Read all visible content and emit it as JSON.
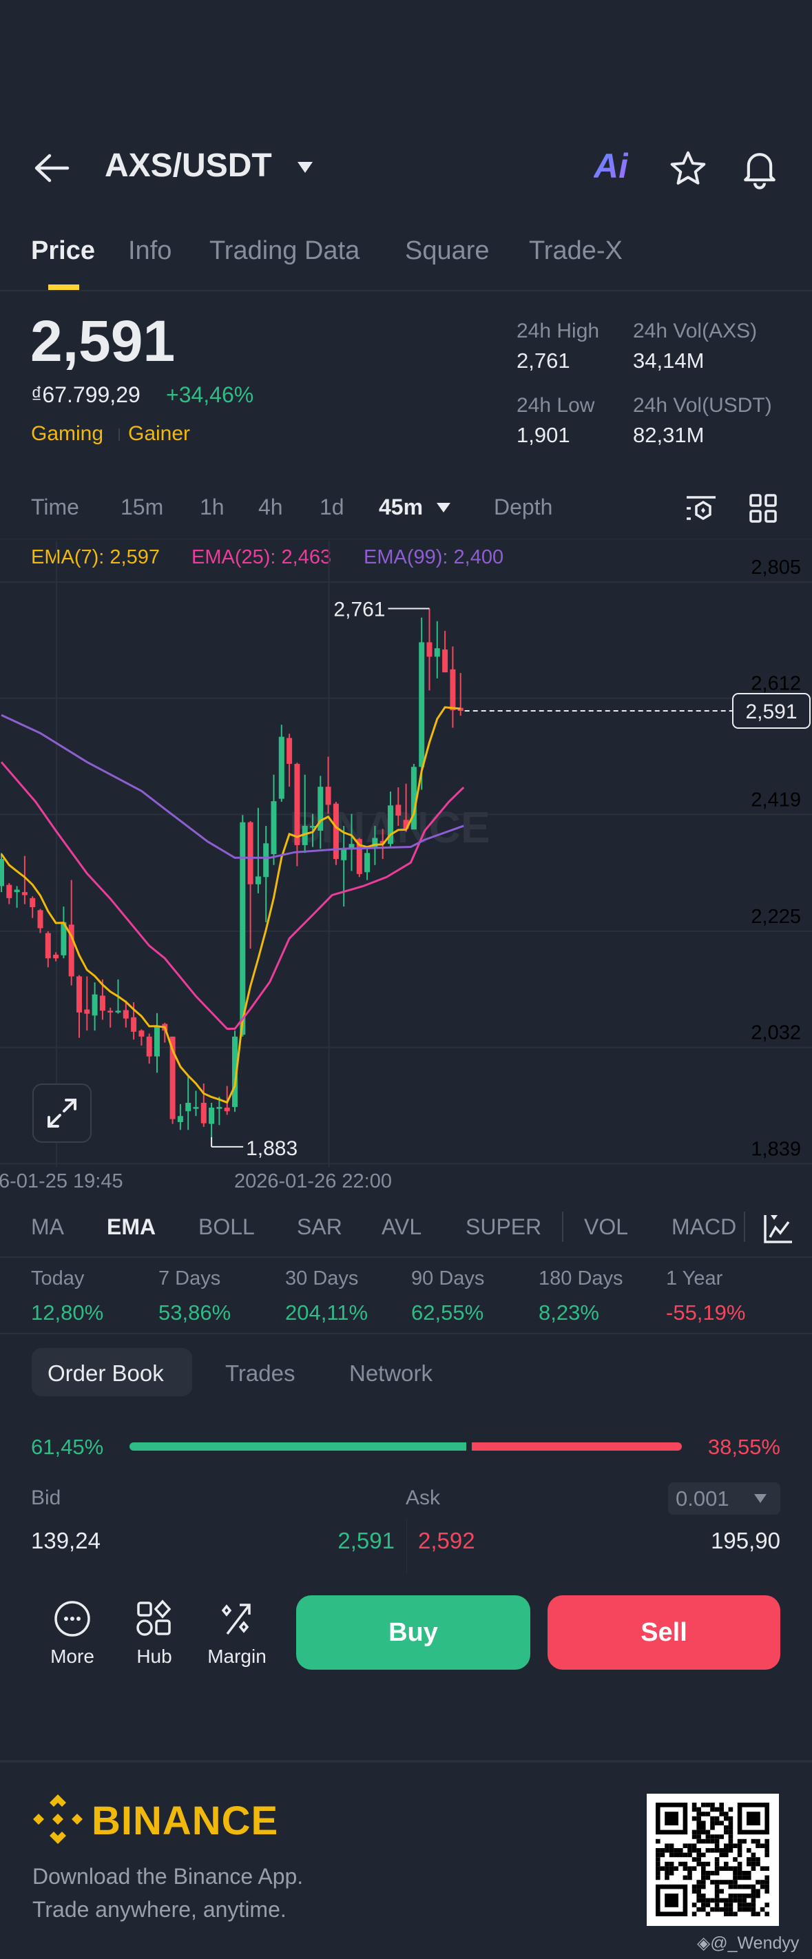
{
  "header": {
    "pair": "AXS/USDT",
    "ai_label": "Ai"
  },
  "tabs": [
    "Price",
    "Info",
    "Trading Data",
    "Square",
    "Trade-X"
  ],
  "price": {
    "last": "2,591",
    "fiat": "₫67.799,29",
    "change": "+34,46%",
    "tags": [
      "Gaming",
      "Gainer"
    ]
  },
  "stats": {
    "high_label": "24h High",
    "high": "2,761",
    "low_label": "24h Low",
    "low": "1,901",
    "vol_base_label": "24h Vol(AXS)",
    "vol_base": "34,14M",
    "vol_quote_label": "24h Vol(USDT)",
    "vol_quote": "82,31M"
  },
  "intervals": [
    "Time",
    "15m",
    "1h",
    "4h",
    "1d",
    "45m",
    "Depth"
  ],
  "ema_legend": {
    "ema7": "EMA(7): 2,597",
    "ema25": "EMA(25): 2,463",
    "ema99": "EMA(99): 2,400"
  },
  "watermark": "BINANCE",
  "chart_data": {
    "type": "candlestick",
    "ylim": [
      1839,
      2805
    ],
    "y_ticks": [
      "2,805",
      "2,612",
      "2,419",
      "2,225",
      "2,032",
      "1,839"
    ],
    "y_tick_values": [
      2805,
      2612,
      2419,
      2225,
      2032,
      1839
    ],
    "x_labels": [
      "6-01-25 19:45",
      "2026-01-26 22:00"
    ],
    "x_label_index": [
      7,
      42
    ],
    "current_price": 2591,
    "current_price_label": "2,591",
    "high_marker": {
      "index": 55,
      "value": 2761,
      "label": "2,761"
    },
    "low_marker": {
      "index": 27,
      "value": 1883,
      "label": "1,883"
    },
    "colors": {
      "up": "#2ebd85",
      "down": "#f6465d",
      "ema7": "#f0b90b",
      "ema25": "#ea3d9c",
      "ema99": "#8e5fd0"
    },
    "ema7_seed": 2356,
    "ohlc": [
      [
        2300,
        2355,
        2290,
        2345
      ],
      [
        2302,
        2305,
        2270,
        2280
      ],
      [
        2290,
        2300,
        2264,
        2294
      ],
      [
        2290,
        2350,
        2270,
        2285
      ],
      [
        2280,
        2283,
        2247,
        2265
      ],
      [
        2260,
        2262,
        2222,
        2230
      ],
      [
        2222,
        2225,
        2165,
        2180
      ],
      [
        2186,
        2190,
        2175,
        2180
      ],
      [
        2185,
        2266,
        2180,
        2240
      ],
      [
        2236,
        2310,
        2135,
        2150
      ],
      [
        2150,
        2152,
        2048,
        2090
      ],
      [
        2095,
        2150,
        2060,
        2088
      ],
      [
        2085,
        2140,
        2060,
        2120
      ],
      [
        2118,
        2145,
        2078,
        2093
      ],
      [
        2093,
        2098,
        2065,
        2090
      ],
      [
        2090,
        2145,
        2088,
        2093
      ],
      [
        2094,
        2110,
        2065,
        2080
      ],
      [
        2082,
        2107,
        2045,
        2058
      ],
      [
        2060,
        2062,
        2035,
        2050
      ],
      [
        2050,
        2055,
        2005,
        2017
      ],
      [
        2017,
        2089,
        1990,
        2068
      ],
      [
        2071,
        2073,
        2040,
        2060
      ],
      [
        2050,
        2050,
        1905,
        1913
      ],
      [
        1908,
        1938,
        1895,
        1918
      ],
      [
        1926,
        1985,
        1895,
        1940
      ],
      [
        1930,
        1960,
        1918,
        1933
      ],
      [
        1940,
        1972,
        1900,
        1906
      ],
      [
        1905,
        1940,
        1883,
        1932
      ],
      [
        1930,
        1950,
        1903,
        1933
      ],
      [
        1932,
        1968,
        1920,
        1926
      ],
      [
        1933,
        2060,
        1925,
        2050
      ],
      [
        2053,
        2418,
        2050,
        2406
      ],
      [
        2406,
        2408,
        2196,
        2303
      ],
      [
        2303,
        2430,
        2288,
        2316
      ],
      [
        2315,
        2400,
        2240,
        2371
      ],
      [
        2353,
        2485,
        2335,
        2441
      ],
      [
        2445,
        2568,
        2440,
        2548
      ],
      [
        2546,
        2553,
        2465,
        2503
      ],
      [
        2503,
        2505,
        2333,
        2368
      ],
      [
        2368,
        2485,
        2355,
        2400
      ],
      [
        2397,
        2420,
        2365,
        2400
      ],
      [
        2392,
        2483,
        2362,
        2465
      ],
      [
        2465,
        2515,
        2420,
        2435
      ],
      [
        2437,
        2440,
        2335,
        2345
      ],
      [
        2343,
        2400,
        2266,
        2363
      ],
      [
        2363,
        2420,
        2325,
        2370
      ],
      [
        2378,
        2380,
        2315,
        2320
      ],
      [
        2323,
        2365,
        2310,
        2355
      ],
      [
        2363,
        2400,
        2335,
        2380
      ],
      [
        2375,
        2395,
        2345,
        2371
      ],
      [
        2370,
        2457,
        2365,
        2434
      ],
      [
        2435,
        2464,
        2400,
        2417
      ],
      [
        2410,
        2470,
        2390,
        2395
      ],
      [
        2394,
        2503,
        2395,
        2498
      ],
      [
        2498,
        2746,
        2460,
        2705
      ],
      [
        2705,
        2761,
        2625,
        2681
      ],
      [
        2681,
        2740,
        2645,
        2695
      ],
      [
        2693,
        2724,
        2655,
        2655
      ],
      [
        2660,
        2698,
        2563,
        2592
      ],
      [
        2596,
        2654,
        2583,
        2591
      ]
    ],
    "ema25_points": [
      [
        0,
        2506
      ],
      [
        4.4,
        2440
      ],
      [
        7,
        2392
      ],
      [
        11,
        2321
      ],
      [
        14,
        2279
      ],
      [
        19,
        2201
      ],
      [
        21,
        2180
      ],
      [
        25,
        2117
      ],
      [
        29,
        2063
      ],
      [
        30,
        2063
      ],
      [
        32,
        2096
      ],
      [
        34.5,
        2141
      ],
      [
        37,
        2213
      ],
      [
        40,
        2252
      ],
      [
        42.5,
        2285
      ],
      [
        46.5,
        2300
      ],
      [
        49.5,
        2315
      ],
      [
        52.6,
        2339
      ],
      [
        54.4,
        2392
      ],
      [
        57.5,
        2440
      ],
      [
        59.4,
        2464
      ]
    ],
    "ema99_points": [
      [
        0,
        2584
      ],
      [
        5,
        2554
      ],
      [
        11,
        2506
      ],
      [
        18,
        2458
      ],
      [
        21,
        2428
      ],
      [
        26.5,
        2374
      ],
      [
        30,
        2347
      ],
      [
        34.5,
        2347
      ],
      [
        37.6,
        2356
      ],
      [
        44,
        2362
      ],
      [
        52.6,
        2365
      ],
      [
        54.4,
        2377
      ],
      [
        59.4,
        2400
      ]
    ]
  },
  "indicators": [
    "MA",
    "EMA",
    "BOLL",
    "SAR",
    "AVL",
    "SUPER",
    "VOL",
    "MACD"
  ],
  "periods": [
    {
      "label": "Today",
      "value": "12,80%",
      "dir": "up"
    },
    {
      "label": "7 Days",
      "value": "53,86%",
      "dir": "up"
    },
    {
      "label": "30 Days",
      "value": "204,11%",
      "dir": "up"
    },
    {
      "label": "90 Days",
      "value": "62,55%",
      "dir": "up"
    },
    {
      "label": "180 Days",
      "value": "8,23%",
      "dir": "up"
    },
    {
      "label": "1 Year",
      "value": "-55,19%",
      "dir": "dn"
    }
  ],
  "orderbook": {
    "tabs": [
      "Order Book",
      "Trades",
      "Network"
    ],
    "bid_pct": "61,45%",
    "ask_pct": "38,55%",
    "bid_ratio": 61.45,
    "bid_label": "Bid",
    "ask_label": "Ask",
    "precision": "0.001",
    "rows": [
      {
        "bid_qty": "139,24",
        "bid_price": "2,591",
        "ask_price": "2,592",
        "ask_qty": "195,90"
      }
    ]
  },
  "bottom": {
    "more": "More",
    "hub": "Hub",
    "margin": "Margin",
    "buy": "Buy",
    "sell": "Sell"
  },
  "footer": {
    "brand": "BINANCE",
    "line1": "Download the Binance App.",
    "line2": "Trade anywhere, anytime.",
    "credit": "@_Wendyy"
  }
}
